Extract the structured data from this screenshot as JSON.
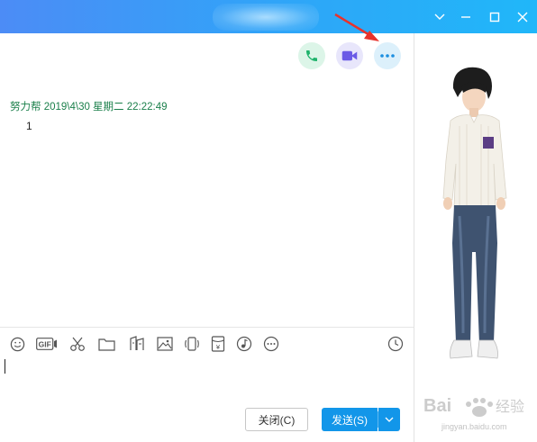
{
  "window": {
    "minimize_label": "minimize",
    "maximize_label": "maximize",
    "close_label": "close"
  },
  "header_actions": {
    "voice_call": "phone-icon",
    "video_call": "video-icon",
    "more": "more-icon"
  },
  "message": {
    "meta": "努力帮 2019\\4\\30 星期二 22:22:49",
    "text": "1"
  },
  "toolbar": {
    "tools": [
      "emoji-icon",
      "gif-icon",
      "screenshot-scissors-icon",
      "folder-icon",
      "font-style-icon",
      "image-icon",
      "shake-icon",
      "red-packet-icon",
      "music-icon",
      "more-icon"
    ],
    "history": "history-clock-icon",
    "gif_text": "GIF",
    "redpacket_text": "¥"
  },
  "buttons": {
    "close_label": "关闭(C)",
    "send_label": "发送(S)"
  },
  "watermark": {
    "brand": "Bai",
    "brand_cn": "经验",
    "url": "jingyan.baidu.com"
  },
  "colors": {
    "titlebar_start": "#4c8cf6",
    "titlebar_end": "#20b7f9",
    "send_button": "#1296e9",
    "message_meta": "#1a7f4a",
    "arrow": "#e8322c"
  }
}
